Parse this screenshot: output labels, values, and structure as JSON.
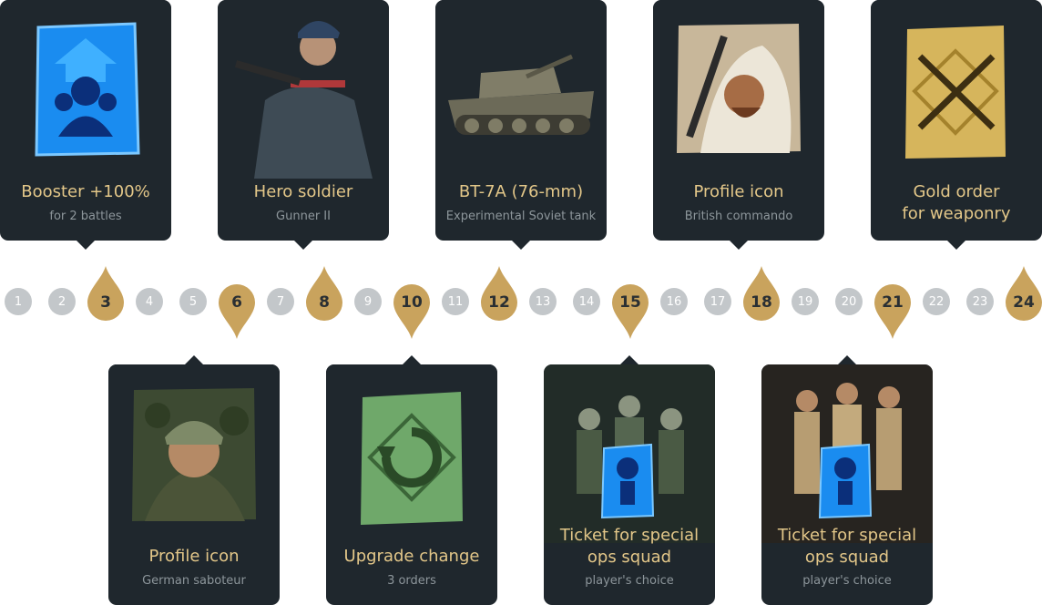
{
  "rewards_top": [
    {
      "title": "Booster +100%",
      "subtitle": "for 2 battles",
      "day": 3,
      "icon": "booster-card-icon",
      "accent": "#1e8fef"
    },
    {
      "title": "Hero soldier",
      "subtitle": "Gunner II",
      "day": 8,
      "icon": "hero-soldier-portrait"
    },
    {
      "title": "BT-7A (76-mm)",
      "subtitle": "Experimental Soviet tank",
      "day": 12,
      "icon": "tank-icon"
    },
    {
      "title": "Profile icon",
      "subtitle": "British commando",
      "day": 18,
      "icon": "profile-icon-british-commando"
    },
    {
      "title_line1": "Gold order",
      "title_line2": "for weaponry",
      "day": 24,
      "icon": "gold-order-icon",
      "accent": "#d6b55c"
    }
  ],
  "rewards_bottom": [
    {
      "title": "Profile icon",
      "subtitle": "German saboteur",
      "day": 6,
      "icon": "profile-icon-german-saboteur"
    },
    {
      "title": "Upgrade change",
      "subtitle": "3 orders",
      "day": 10,
      "icon": "upgrade-order-icon",
      "accent": "#6fa86a"
    },
    {
      "title_line1": "Ticket for special",
      "title_line2": "ops squad",
      "subtitle": "player's choice",
      "day": 15,
      "icon": "squad-ticket-icon"
    },
    {
      "title_line1": "Ticket for special",
      "title_line2": "ops squad",
      "subtitle": "player's choice",
      "day": 21,
      "icon": "squad-ticket-icon"
    }
  ],
  "days": [
    "1",
    "2",
    "3",
    "4",
    "5",
    "6",
    "7",
    "8",
    "9",
    "10",
    "11",
    "12",
    "13",
    "14",
    "15",
    "16",
    "17",
    "18",
    "19",
    "20",
    "21",
    "22",
    "23",
    "24"
  ],
  "colors": {
    "card_bg": "#1f272d",
    "title": "#e3c789",
    "subtitle": "#8d969b",
    "day_circle": "#c3c7ca",
    "marker_gold": "#c9a35d"
  }
}
